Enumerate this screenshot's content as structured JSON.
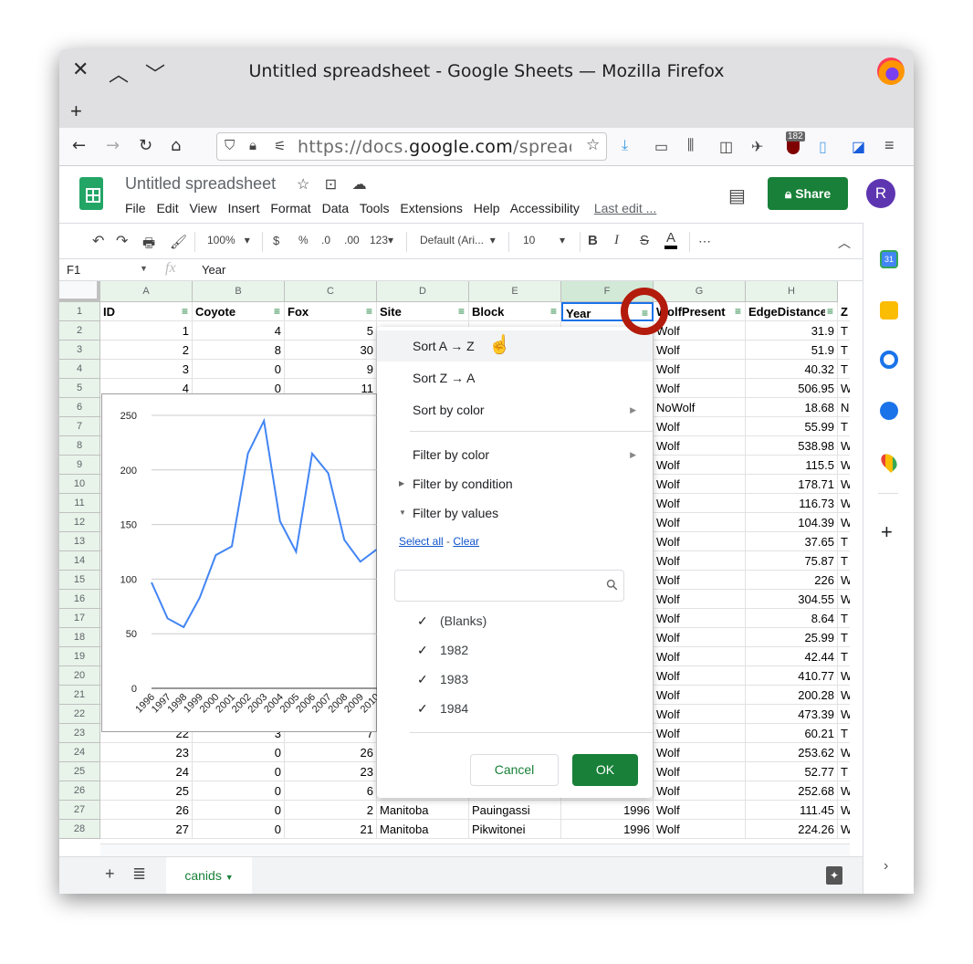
{
  "browser": {
    "window_title": "Untitled spreadsheet - Google Sheets — Mozilla Firefox",
    "url_host_prefix": "https://docs.",
    "url_host": "google.com",
    "url_path": "/spreadsheets",
    "extension_badge": "182",
    "icons": [
      "close-icon",
      "chevron-up-icon",
      "chevron-down-icon",
      "new-tab-icon",
      "back-icon",
      "forward-icon",
      "reload-icon",
      "home-icon",
      "shield-icon",
      "lock-icon",
      "permissions-icon",
      "bookmark-star-icon",
      "download-icon",
      "window-icon",
      "library-icon",
      "reader-icon",
      "extension-icon",
      "ublock-icon",
      "document-icon",
      "bitwarden-icon",
      "menu-icon"
    ]
  },
  "doc": {
    "title": "Untitled spreadsheet",
    "menus": [
      "File",
      "Edit",
      "View",
      "Insert",
      "Format",
      "Data",
      "Tools",
      "Extensions",
      "Help",
      "Accessibility"
    ],
    "last_edit": "Last edit ...",
    "share_label": "Share",
    "avatar_initial": "R"
  },
  "toolbar": {
    "zoom": "100%",
    "currency": "$",
    "percent": "%",
    "dec_decrease": ".0",
    "dec_increase": ".00",
    "more_formats": "123",
    "font": "Default (Ari...",
    "font_size": "10",
    "bold": "B",
    "italic": "I",
    "strike": "S",
    "text_color": "A",
    "more": "⋯"
  },
  "formula": {
    "name_box": "F1",
    "fx": "fx",
    "value": "Year"
  },
  "grid": {
    "columns": [
      "A",
      "B",
      "C",
      "D",
      "E",
      "F",
      "G",
      "H"
    ],
    "selected_column": "F",
    "headers": [
      "ID",
      "Coyote",
      "Fox",
      "Site",
      "Block",
      "Year",
      "WolfPresent",
      "EdgeDistance",
      "Z"
    ],
    "rows": [
      {
        "n": "1"
      },
      {
        "n": "2",
        "a": "1",
        "b": "4",
        "c": "5",
        "g": "Wolf",
        "h": "31.9",
        "i": "T"
      },
      {
        "n": "3",
        "a": "2",
        "b": "8",
        "c": "30",
        "g": "Wolf",
        "h": "51.9",
        "i": "T"
      },
      {
        "n": "4",
        "a": "3",
        "b": "0",
        "c": "9",
        "g": "Wolf",
        "h": "40.32",
        "i": "T"
      },
      {
        "n": "5",
        "a": "4",
        "b": "0",
        "c": "11",
        "g": "Wolf",
        "h": "506.95",
        "i": "W"
      },
      {
        "n": "6",
        "g": "NoWolf",
        "h": "18.68",
        "i": "N"
      },
      {
        "n": "7",
        "g": "Wolf",
        "h": "55.99",
        "i": "T"
      },
      {
        "n": "8",
        "g": "Wolf",
        "h": "538.98",
        "i": "W"
      },
      {
        "n": "9",
        "g": "Wolf",
        "h": "115.5",
        "i": "W"
      },
      {
        "n": "10",
        "g": "Wolf",
        "h": "178.71",
        "i": "W"
      },
      {
        "n": "11",
        "g": "Wolf",
        "h": "116.73",
        "i": "W"
      },
      {
        "n": "12",
        "g": "Wolf",
        "h": "104.39",
        "i": "W"
      },
      {
        "n": "13",
        "g": "Wolf",
        "h": "37.65",
        "i": "T"
      },
      {
        "n": "14",
        "g": "Wolf",
        "h": "75.87",
        "i": "T"
      },
      {
        "n": "15",
        "g": "Wolf",
        "h": "226",
        "i": "W"
      },
      {
        "n": "16",
        "g": "Wolf",
        "h": "304.55",
        "i": "W"
      },
      {
        "n": "17",
        "g": "Wolf",
        "h": "8.64",
        "i": "T"
      },
      {
        "n": "18",
        "g": "Wolf",
        "h": "25.99",
        "i": "T"
      },
      {
        "n": "19",
        "g": "Wolf",
        "h": "42.44",
        "i": "T"
      },
      {
        "n": "20",
        "g": "Wolf",
        "h": "410.77",
        "i": "W"
      },
      {
        "n": "21",
        "g": "Wolf",
        "h": "200.28",
        "i": "W"
      },
      {
        "n": "22",
        "g": "Wolf",
        "h": "473.39",
        "i": "W"
      },
      {
        "n": "23",
        "a": "22",
        "b": "3",
        "c": "7",
        "g": "Wolf",
        "h": "60.21",
        "i": "T"
      },
      {
        "n": "24",
        "a": "23",
        "b": "0",
        "c": "26",
        "g": "Wolf",
        "h": "253.62",
        "i": "W"
      },
      {
        "n": "25",
        "a": "24",
        "b": "0",
        "c": "23",
        "g": "Wolf",
        "h": "52.77",
        "i": "T"
      },
      {
        "n": "26",
        "a": "25",
        "b": "0",
        "c": "6",
        "g": "Wolf",
        "h": "252.68",
        "i": "W"
      },
      {
        "n": "27",
        "a": "26",
        "b": "0",
        "c": "2",
        "d": "Manitoba",
        "e": "Pauingassi",
        "f": "1996",
        "g": "Wolf",
        "h": "111.45",
        "i": "W"
      },
      {
        "n": "28",
        "a": "27",
        "b": "0",
        "c": "21",
        "d": "Manitoba",
        "e": "Pikwitonei",
        "f": "1996",
        "g": "Wolf",
        "h": "224.26",
        "i": "W"
      }
    ]
  },
  "filter_menu": {
    "sort_az": "Sort A → Z",
    "sort_za": "Sort Z → A",
    "sort_by_color": "Sort by color",
    "filter_by_color": "Filter by color",
    "filter_by_condition": "Filter by condition",
    "filter_by_values": "Filter by values",
    "select_all": "Select all",
    "link_sep": " - ",
    "clear": "Clear",
    "search_value": "",
    "values": [
      {
        "label": "(Blanks)",
        "checked": true
      },
      {
        "label": "1982",
        "checked": true
      },
      {
        "label": "1983",
        "checked": true
      },
      {
        "label": "1984",
        "checked": true
      }
    ],
    "cancel": "Cancel",
    "ok": "OK"
  },
  "sheets": {
    "active": "canids"
  },
  "colors": {
    "accent_green": "#188038",
    "line_blue": "#4285f4",
    "highlight_red": "#b31b0c",
    "avatar_purple": "#5e35b1"
  },
  "chart_data": {
    "type": "line",
    "title": "",
    "xlabel": "",
    "ylabel": "",
    "x": [
      "1996",
      "1997",
      "1998",
      "1999",
      "2000",
      "2001",
      "2002",
      "2003",
      "2004",
      "2005",
      "2006",
      "2007",
      "2008",
      "2009",
      "2010"
    ],
    "series": [
      {
        "name": "",
        "values": [
          97,
          64,
          56,
          83,
          122,
          130,
          215,
          245,
          153,
          125,
          215,
          197,
          136,
          116,
          127
        ]
      }
    ],
    "yticks": [
      "0",
      "50",
      "100",
      "150",
      "200",
      "250"
    ],
    "ylim": [
      0,
      260
    ],
    "grid": true,
    "legend": "none"
  }
}
